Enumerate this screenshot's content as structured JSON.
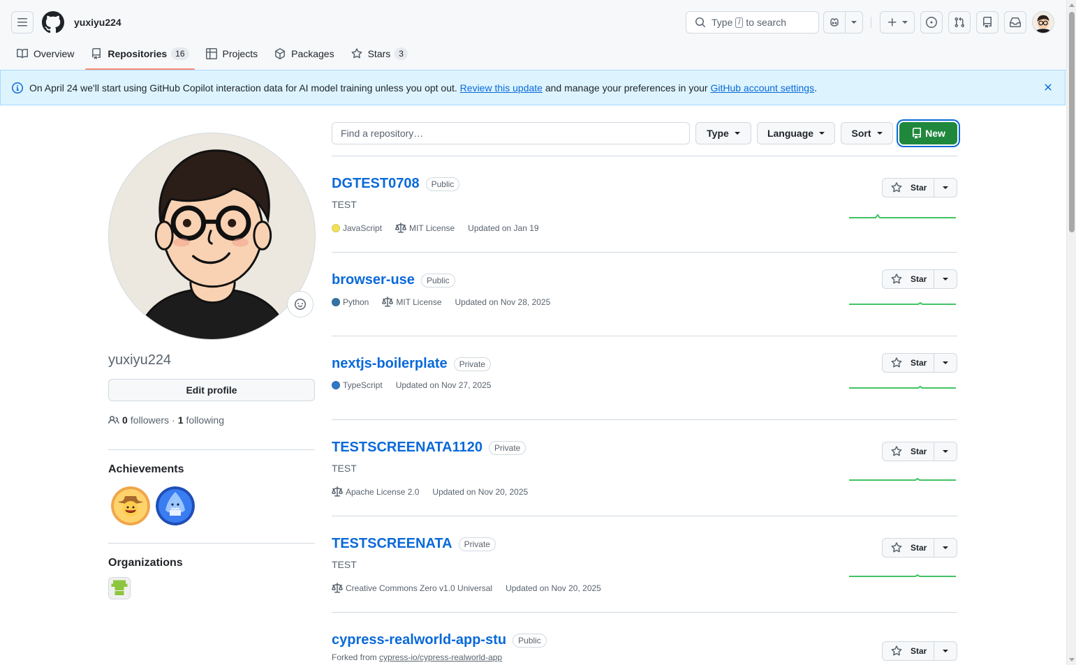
{
  "header": {
    "username": "yuxiyu224",
    "search": {
      "prefix": "Type",
      "key": "/",
      "suffix": "to search"
    }
  },
  "tabs": [
    {
      "label": "Overview",
      "icon": "book-icon"
    },
    {
      "label": "Repositories",
      "count": "16",
      "icon": "repo-icon",
      "selected": true
    },
    {
      "label": "Projects",
      "icon": "table-icon"
    },
    {
      "label": "Packages",
      "icon": "package-icon"
    },
    {
      "label": "Stars",
      "count": "3",
      "icon": "star-icon"
    }
  ],
  "banner": {
    "text_before": "On April 24 we'll start using GitHub Copilot interaction data for AI model training unless you opt out.",
    "link1": "Review this update",
    "text_middle": "and manage your preferences in your",
    "link2": "GitHub account settings",
    "text_after": "."
  },
  "profile": {
    "login": "yuxiyu224",
    "edit_label": "Edit profile",
    "followers_count": "0",
    "followers_label": "followers",
    "separator": "·",
    "following_count": "1",
    "following_label": "following",
    "achievements_title": "Achievements",
    "organizations_title": "Organizations"
  },
  "filters": {
    "find_placeholder": "Find a repository…",
    "type_label": "Type",
    "language_label": "Language",
    "sort_label": "Sort",
    "new_label": "New"
  },
  "repos": [
    {
      "name": "DGTEST0708",
      "visibility": "Public",
      "description": "TEST",
      "language": "JavaScript",
      "lang_color": "#f1e05a",
      "license": "MIT License",
      "updated": "Updated on Jan 19",
      "star_label": "Star"
    },
    {
      "name": "browser-use",
      "visibility": "Public",
      "description": "",
      "language": "Python",
      "lang_color": "#3572A5",
      "license": "MIT License",
      "updated": "Updated on Nov 28, 2025",
      "star_label": "Star"
    },
    {
      "name": "nextjs-boilerplate",
      "visibility": "Private",
      "description": "",
      "language": "TypeScript",
      "lang_color": "#3178c6",
      "license": "",
      "updated": "Updated on Nov 27, 2025",
      "star_label": "Star"
    },
    {
      "name": "TESTSCREENATA1120",
      "visibility": "Private",
      "description": "TEST",
      "language": "",
      "lang_color": "",
      "license": "Apache License 2.0",
      "updated": "Updated on Nov 20, 2025",
      "star_label": "Star"
    },
    {
      "name": "TESTSCREENATA",
      "visibility": "Private",
      "description": "TEST",
      "language": "",
      "lang_color": "",
      "license": "Creative Commons Zero v1.0 Universal",
      "updated": "Updated on Nov 20, 2025",
      "star_label": "Star"
    },
    {
      "name": "cypress-realworld-app-stu",
      "visibility": "Public",
      "forked_prefix": "Forked from",
      "forked_from": "cypress-io/cypress-realworld-app",
      "star_label": "Star"
    }
  ],
  "colors": {
    "accent": "#0969da",
    "new_button": "#1f883d",
    "tab_underline": "#fd8c73",
    "banner_bg": "#ddf4ff",
    "sparkline": "#40c463"
  }
}
